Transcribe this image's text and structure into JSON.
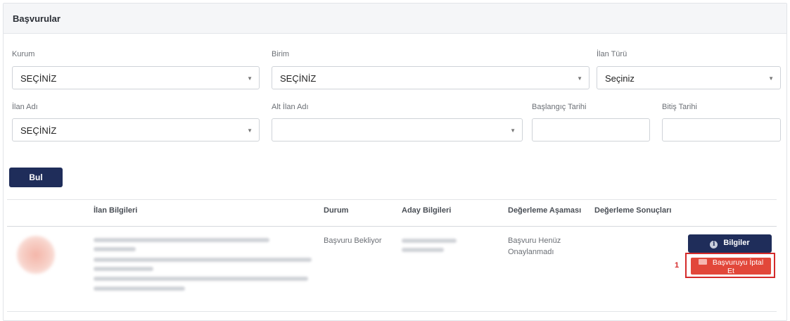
{
  "panel": {
    "title": "Başvurular"
  },
  "filters": {
    "kurum": {
      "label": "Kurum",
      "value": "SEÇİNİZ"
    },
    "birim": {
      "label": "Birim",
      "value": "SEÇİNİZ"
    },
    "ilan_turu": {
      "label": "İlan Türü",
      "value": "Seçiniz"
    },
    "ilan_adi": {
      "label": "İlan Adı",
      "value": "SEÇİNİZ"
    },
    "alt_ilan_adi": {
      "label": "Alt İlan Adı",
      "value": ""
    },
    "baslangic_tarihi": {
      "label": "Başlangıç Tarihi",
      "value": ""
    },
    "bitis_tarihi": {
      "label": "Bitiş Tarihi",
      "value": ""
    }
  },
  "search_button": {
    "label": "Bul"
  },
  "table": {
    "headers": {
      "ilan_bilgileri": "İlan Bilgileri",
      "durum": "Durum",
      "aday_bilgileri": "Aday Bilgileri",
      "degerleme_asamasi": "Değerleme Aşaması",
      "degerleme_sonuclari": "Değerleme Sonuçları"
    },
    "rows": [
      {
        "durum": "Başvuru Bekliyor",
        "degerleme_asamasi_line1": "Başvuru Henüz",
        "degerleme_asamasi_line2": "Onaylanmadı",
        "info_button": "Bilgiler",
        "cancel_button": "Başvuruyu İptal Et",
        "annotation_number": "1"
      }
    ]
  },
  "colors": {
    "primary_navy": "#1f2d5a",
    "cancel_red": "#e2473a",
    "highlight_red": "#d42a2a"
  },
  "icons": {
    "info": "info-circle-icon",
    "cancel": "backspace-icon",
    "dropdown": "caret-down-icon"
  }
}
